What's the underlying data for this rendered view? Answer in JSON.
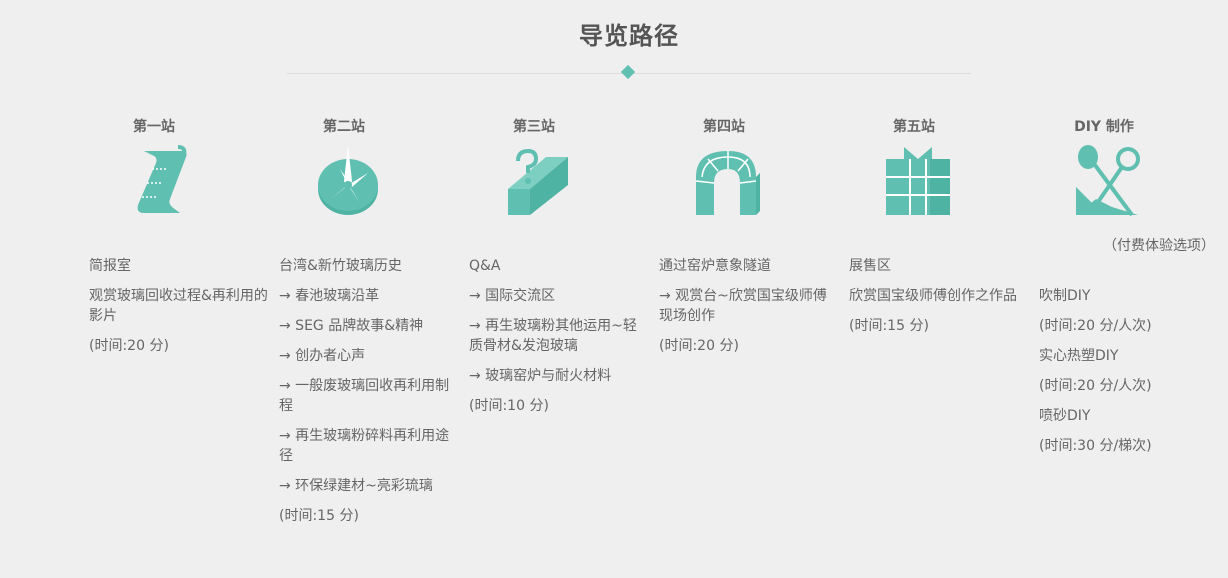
{
  "header": {
    "title": "导览路径"
  },
  "colors": {
    "accent": "#5fbfb0",
    "text": "#666666",
    "background": "#efefef"
  },
  "stations": [
    {
      "title": "第一站",
      "icon": "scroll-icon",
      "lines": [
        "简报室",
        "观赏玻璃回收过程&再利用的影片",
        "(时间:20 分)"
      ]
    },
    {
      "title": "第二站",
      "icon": "compass-icon",
      "lines": [
        "台湾&新竹玻璃历史",
        "→ 春池玻璃沿革",
        "→ SEG 品牌故事&精神",
        "→ 创办者心声",
        "→ 一般废玻璃回收再利用制程",
        "→ 再生玻璃粉碎料再利用途径",
        "→ 环保绿建材~亮彩琉璃",
        "(时间:15 分)"
      ]
    },
    {
      "title": "第三站",
      "icon": "question-box-icon",
      "lines": [
        "Q&A",
        "→ 国际交流区",
        "→ 再生玻璃粉其他运用~轻质骨材&发泡玻璃",
        "→ 玻璃窑炉与耐火材料",
        "(时间:10 分)"
      ]
    },
    {
      "title": "第四站",
      "icon": "kiln-tunnel-icon",
      "lines": [
        "通过窑炉意象隧道",
        "→ 观赏台~欣赏国宝级师傅现场创作",
        "(时间:20 分)"
      ]
    },
    {
      "title": "第五站",
      "icon": "gift-box-icon",
      "lines": [
        "展售区",
        "欣赏国宝级师傅创作之作品",
        "(时间:15 分)"
      ]
    },
    {
      "title": "DIY 制作",
      "icon": "diy-tools-icon",
      "note": "（付费体验选项）",
      "lines": [
        "吹制DIY",
        "(时间:20 分/人次)",
        "实心热塑DIY",
        "(时间:20 分/人次)",
        "喷砂DIY",
        "(时间:30 分/梯次)"
      ]
    }
  ]
}
